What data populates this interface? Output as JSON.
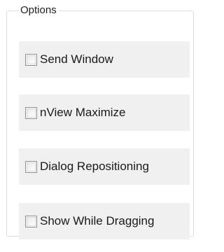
{
  "group": {
    "title": "Options"
  },
  "options": [
    {
      "label": "Send Window",
      "checked": false
    },
    {
      "label": "nView Maximize",
      "checked": false
    },
    {
      "label": "Dialog Repositioning",
      "checked": false
    },
    {
      "label": "Show While Dragging",
      "checked": false
    }
  ]
}
